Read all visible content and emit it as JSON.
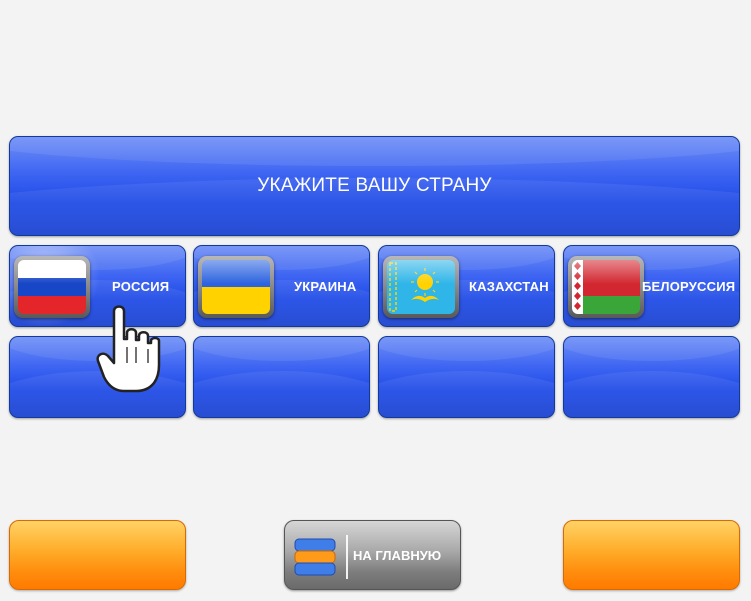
{
  "header": {
    "title": "УКАЖИТЕ ВАШУ СТРАНУ"
  },
  "countries": [
    {
      "label": "РОССИЯ",
      "flag": "russia-flag"
    },
    {
      "label": "УКРАИНА",
      "flag": "ukraine-flag"
    },
    {
      "label": "КАЗАХСТАН",
      "flag": "kazakhstan-flag"
    },
    {
      "label": "БЕЛОРУССИЯ",
      "flag": "belarus-flag"
    }
  ],
  "empty_tiles": 4,
  "footer": {
    "home_label": "НА ГЛАВНУЮ",
    "home_icon": "stack-icon"
  },
  "colors": {
    "tile_blue": "#2450e8",
    "button_orange": "#ff9a1a",
    "home_gray": "#8c8c8c",
    "background": "#f3f3f3"
  }
}
